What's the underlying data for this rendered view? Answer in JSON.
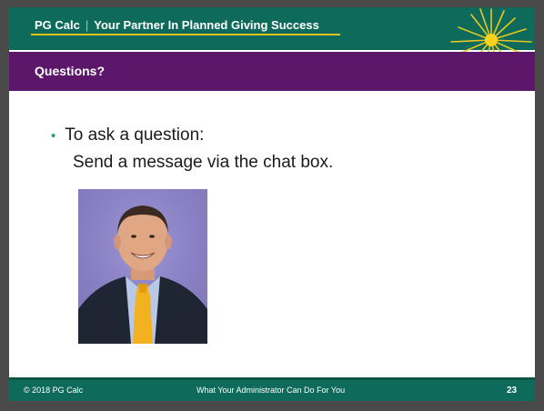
{
  "header": {
    "brand": "PG Calc",
    "separator": "|",
    "tagline": "Your Partner In Planned Giving Success"
  },
  "title_bar": {
    "title": "Questions?"
  },
  "body": {
    "bullet": "To ask a question:",
    "sub_text": "Send a message via the chat box."
  },
  "photo": {
    "alt": "Presenter photo"
  },
  "footer": {
    "copyright": "© 2018 PG Calc",
    "presentation_title": "What Your Administrator Can Do For You",
    "page_number": "23"
  },
  "colors": {
    "header_green": "#0e6b5b",
    "title_purple": "#5c176a",
    "accent_gold": "#e6c21c",
    "bullet_green": "#2aa07a"
  }
}
